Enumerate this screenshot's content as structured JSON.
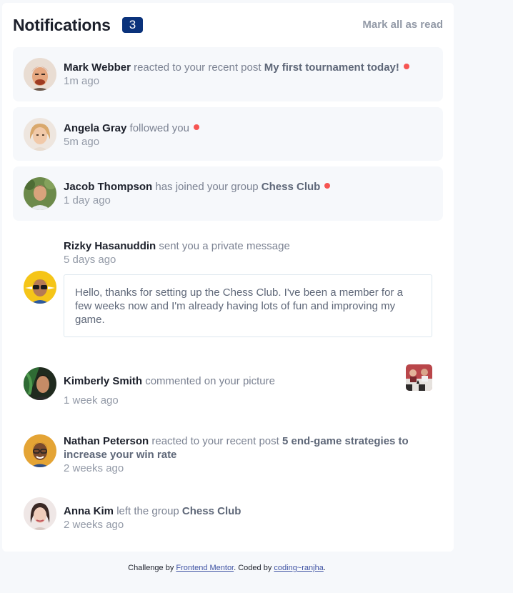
{
  "header": {
    "title": "Notifications",
    "count": "3",
    "mark_all": "Mark all as read"
  },
  "notifications": [
    {
      "name": "Mark Webber",
      "action": "reacted to your recent post",
      "target": "My first tournament today!",
      "time": "1m ago",
      "unread": true
    },
    {
      "name": "Angela Gray",
      "action": "followed you",
      "target": "",
      "time": "5m ago",
      "unread": true
    },
    {
      "name": "Jacob Thompson",
      "action": "has joined your group",
      "target": "Chess Club",
      "time": "1 day ago",
      "unread": true
    },
    {
      "name": "Rizky Hasanuddin",
      "action": "sent you a private message",
      "target": "",
      "time": "5 days ago",
      "unread": false,
      "message": "Hello, thanks for setting up the Chess Club. I've been a member for a few weeks now and I'm already having lots of fun and improving my game."
    },
    {
      "name": "Kimberly Smith",
      "action": "commented on your picture",
      "target": "",
      "time": "1 week ago",
      "unread": false
    },
    {
      "name": "Nathan Peterson",
      "action": "reacted to your recent post",
      "target": "5 end-game strategies to increase your win rate",
      "time": "2 weeks ago",
      "unread": false
    },
    {
      "name": "Anna Kim",
      "action": "left the group",
      "target": "Chess Club",
      "time": "2 weeks ago",
      "unread": false
    }
  ],
  "footer": {
    "prefix": "Challenge by",
    "link1": "Frontend Mentor",
    "middle": ". Coded by",
    "link2": "coding~ranjha",
    "suffix": "."
  },
  "colors": {
    "accent": "#0a327b",
    "unread_dot": "#f65552",
    "unread_bg": "#f6f8fb"
  }
}
